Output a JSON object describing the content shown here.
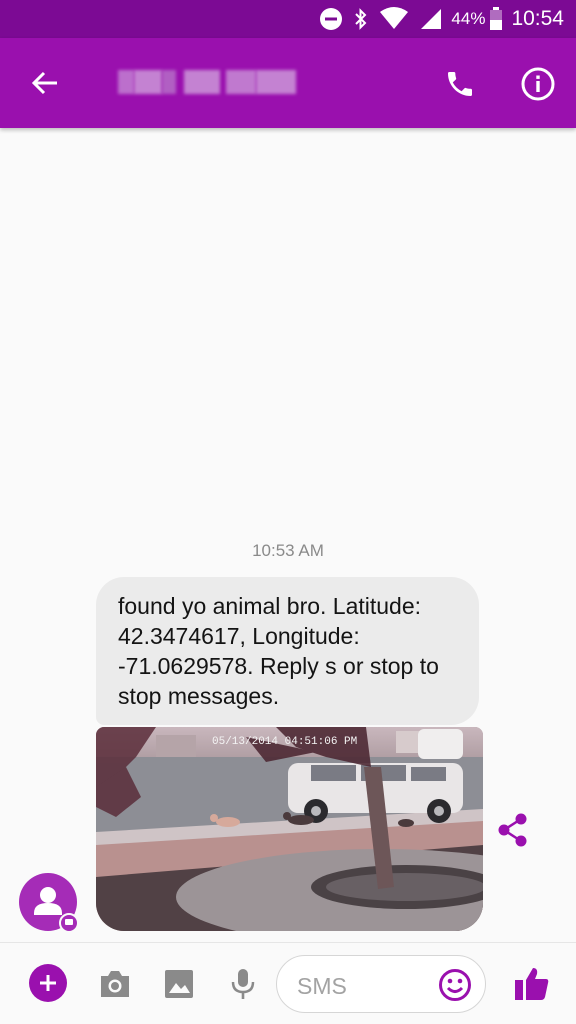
{
  "status_bar": {
    "icons": [
      "do-not-disturb-icon",
      "bluetooth-icon",
      "wifi-icon",
      "cell-signal-icon",
      "battery-icon"
    ],
    "battery": "44%",
    "time": "10:54"
  },
  "app_bar": {
    "contact_name_redacted": true,
    "icons": [
      "back-arrow-icon",
      "phone-icon",
      "info-icon"
    ]
  },
  "conversation": {
    "timestamp": "10:53 AM",
    "message_text": "found yo animal bro. Latitude: 42.3474617, Longitude: -71.0629578. Reply s or stop to stop messages.",
    "photo_caption": "05/13/2014 04:51:06 PM",
    "share_icon": "share-icon",
    "avatar_icon": "person-icon"
  },
  "composer": {
    "placeholder": "SMS",
    "icons": [
      "add-icon",
      "camera-icon",
      "image-icon",
      "microphone-icon",
      "emoji-icon",
      "thumbs-up-icon"
    ]
  },
  "colors": {
    "status_bar": "#7c0a94",
    "app_bar": "#9a10ae",
    "accent": "#9a10ae",
    "bubble": "#ebebeb",
    "background": "#fafafa"
  }
}
